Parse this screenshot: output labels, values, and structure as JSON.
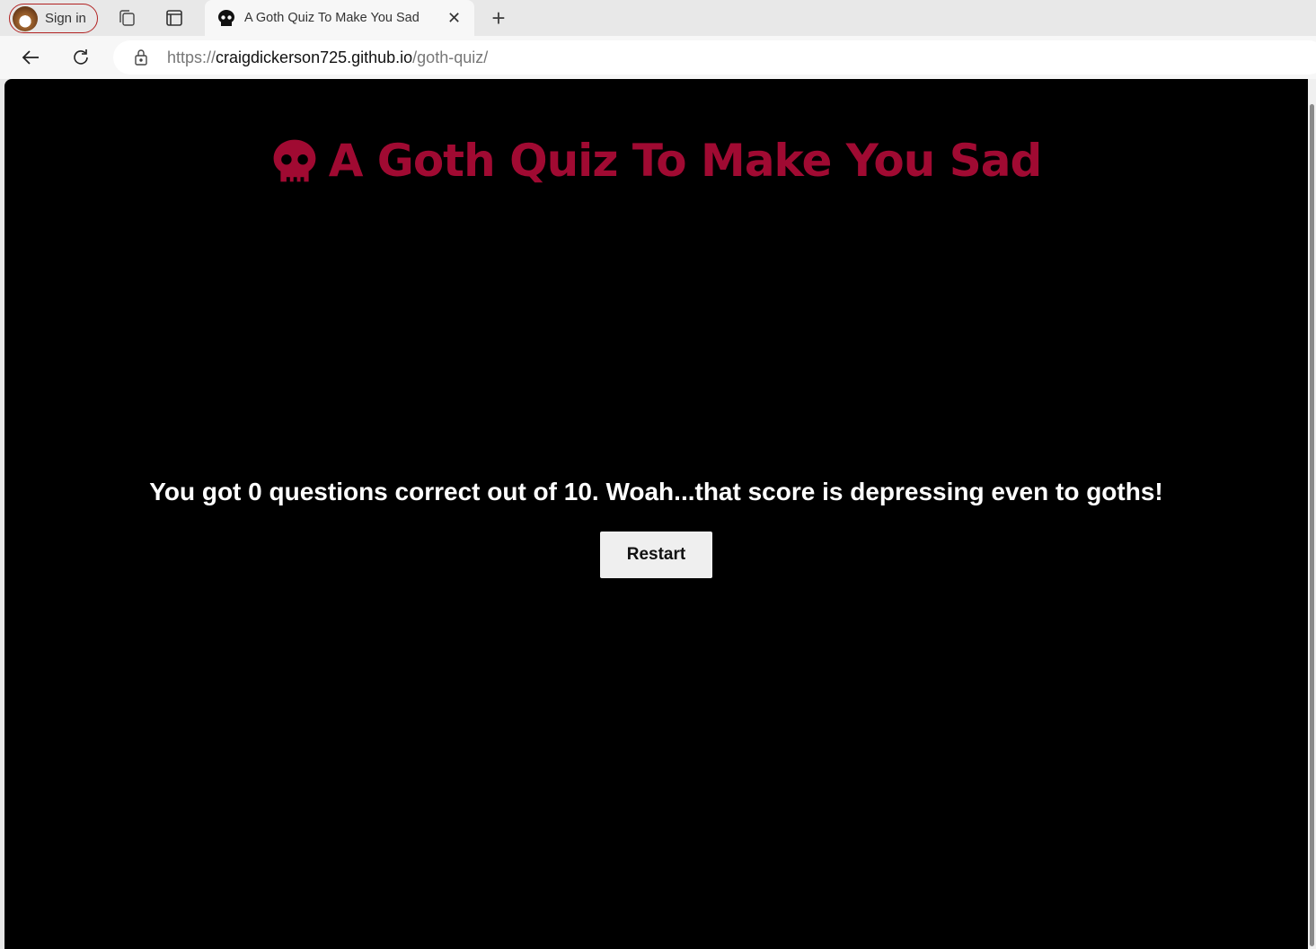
{
  "browser": {
    "sign_in": "Sign in",
    "tab_title": "A Goth Quiz To Make You Sad",
    "url_scheme": "https://",
    "url_host": "craigdickerson725.github.io",
    "url_path": "/goth-quiz/"
  },
  "page": {
    "title": "A Goth Quiz To Make You Sad",
    "result": "You got 0 questions correct out of 10. Woah...that score is depressing even to goths!",
    "restart_label": "Restart",
    "accent": "#a00a32"
  }
}
